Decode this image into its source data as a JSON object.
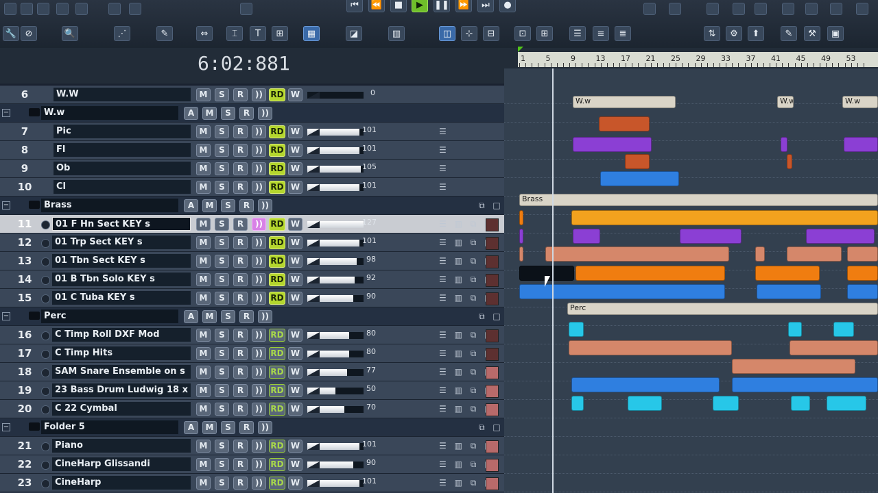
{
  "toolbar": {
    "buttons": [
      "🔧",
      "⊘",
      "🔍",
      "⋰",
      "✎",
      "⇔",
      "⌶",
      "T",
      "⊞",
      "▦",
      "◪",
      "▥",
      "◫",
      "⊹",
      "⊟",
      "⊡",
      "⊞",
      "☰",
      "≡",
      "≣",
      "⇅",
      "⚙",
      "⬆",
      "✎",
      "⚒",
      "▣"
    ],
    "transport": [
      "⏮",
      "⏪",
      "■",
      "▶",
      "❚❚",
      "⏩",
      "⏭",
      "●"
    ]
  },
  "time_display": "6:02:881",
  "ruler": {
    "labels": [
      "1",
      "5",
      "9",
      "13",
      "17",
      "21",
      "25",
      "29",
      "33",
      "37",
      "41",
      "45",
      "49",
      "53"
    ]
  },
  "tracks": [
    {
      "id": "t6",
      "num": "6",
      "name": "W.W",
      "type": "folder-track",
      "volume": "0",
      "vol_level": 0.0,
      "rd": true
    },
    {
      "id": "f-ww",
      "num": "",
      "name": "W.w",
      "type": "folder",
      "collapsed": false
    },
    {
      "id": "t7",
      "num": "7",
      "name": "Pic",
      "type": "track",
      "volume": "101",
      "vol_level": 0.93,
      "rd": true
    },
    {
      "id": "t8",
      "num": "8",
      "name": "Fl",
      "type": "track",
      "volume": "101",
      "vol_level": 0.93,
      "rd": true
    },
    {
      "id": "t9",
      "num": "9",
      "name": "Ob",
      "type": "track",
      "volume": "105",
      "vol_level": 0.95,
      "rd": true
    },
    {
      "id": "t10",
      "num": "10",
      "name": "Cl",
      "type": "track",
      "volume": "101",
      "vol_level": 0.93,
      "rd": true
    },
    {
      "id": "f-brass",
      "num": "",
      "name": "Brass",
      "type": "folder",
      "collapsed": true
    },
    {
      "id": "t11",
      "num": "11",
      "name": "01 F Hn Sect KEY s",
      "type": "track",
      "volume": "127",
      "vol_level": 1.0,
      "rd": true,
      "selected": true,
      "monitor": true
    },
    {
      "id": "t12",
      "num": "12",
      "name": "01 Trp Sect KEY s",
      "type": "track",
      "volume": "101",
      "vol_level": 0.93,
      "rd": true
    },
    {
      "id": "t13",
      "num": "13",
      "name": "01 Tbn Sect KEY s",
      "type": "track",
      "volume": "98",
      "vol_level": 0.88,
      "rd": true
    },
    {
      "id": "t14",
      "num": "14",
      "name": "01 B Tbn Solo KEY s",
      "type": "track",
      "volume": "92",
      "vol_level": 0.84,
      "rd": true
    },
    {
      "id": "t15",
      "num": "15",
      "name": "01 C Tuba KEY s",
      "type": "track",
      "volume": "90",
      "vol_level": 0.82,
      "rd": true
    },
    {
      "id": "f-perc",
      "num": "",
      "name": "Perc",
      "type": "folder",
      "collapsed": true
    },
    {
      "id": "t16",
      "num": "16",
      "name": "C Timp Roll DXF Mod",
      "type": "track",
      "volume": "80",
      "vol_level": 0.74,
      "rd": false
    },
    {
      "id": "t17",
      "num": "17",
      "name": "C Timp Hits",
      "type": "track",
      "volume": "80",
      "vol_level": 0.74,
      "rd": false
    },
    {
      "id": "t18",
      "num": "18",
      "name": "SAM Snare Ensemble on s",
      "type": "track",
      "volume": "77",
      "vol_level": 0.71,
      "rd": false
    },
    {
      "id": "t19",
      "num": "19",
      "name": "23 Bass Drum Ludwig 18 x 40",
      "type": "track",
      "volume": "50",
      "vol_level": 0.5,
      "rd": false
    },
    {
      "id": "t20",
      "num": "20",
      "name": "C 22 Cymbal",
      "type": "track",
      "volume": "70",
      "vol_level": 0.66,
      "rd": false
    },
    {
      "id": "f-5",
      "num": "",
      "name": "Folder 5",
      "type": "folder",
      "collapsed": true
    },
    {
      "id": "t21",
      "num": "21",
      "name": "Piano",
      "type": "track",
      "volume": "101",
      "vol_level": 0.93,
      "rd": false
    },
    {
      "id": "t22",
      "num": "22",
      "name": "CineHarp Glissandi",
      "type": "track",
      "volume": "90",
      "vol_level": 0.82,
      "rd": false
    },
    {
      "id": "t23",
      "num": "23",
      "name": "CineHarp",
      "type": "track",
      "volume": "101",
      "vol_level": 0.93,
      "rd": false
    }
  ],
  "button_labels": {
    "m": "M",
    "s": "S",
    "r": "R",
    "mon": "))",
    "rd": "RD",
    "w": "W",
    "a": "A"
  },
  "clip_labels": {
    "ww": "W.w",
    "brass": "Brass",
    "perc": "Perc"
  },
  "colors": {
    "orange": "#f07d10",
    "yellow": "#f2a21e",
    "purple": "#8b3fd4",
    "salmon": "#d5876a",
    "blue": "#2f7fe0",
    "cyan": "#27c7e8",
    "rust": "#c8562a",
    "folder_clip": "#d9d4c7"
  }
}
